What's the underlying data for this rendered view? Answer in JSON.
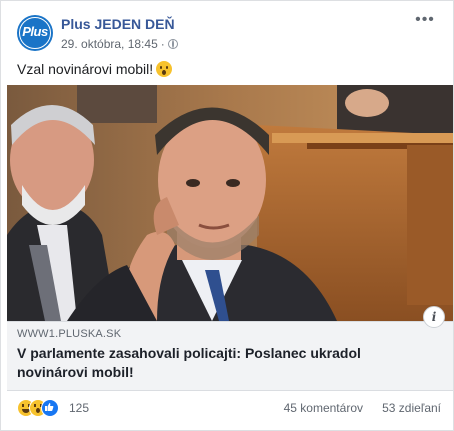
{
  "post": {
    "page_name": "Plus JEDEN DEŇ",
    "avatar_text": "Plus",
    "timestamp": "29. októbra, 18:45",
    "separator": "·",
    "text": "Vzal novinárovi mobil!",
    "text_emoji": "hushed-face-emoji",
    "more_glyph": "•••"
  },
  "link": {
    "domain": "WWW1.PLUSKA.SK",
    "title": "V parlamente zasahovali policajti: Poslanec ukradol novinárovi mobil!",
    "info_glyph": "i"
  },
  "footer": {
    "reactions": [
      "haha",
      "wow",
      "like"
    ],
    "reaction_count": "125",
    "comments": "45 komentárov",
    "shares": "53 zdieľaní"
  },
  "colors": {
    "page_name": "#385898",
    "avatar_bg": "#1a74c7",
    "like_blue": "#1877f2",
    "link_bg": "#f2f3f5"
  }
}
